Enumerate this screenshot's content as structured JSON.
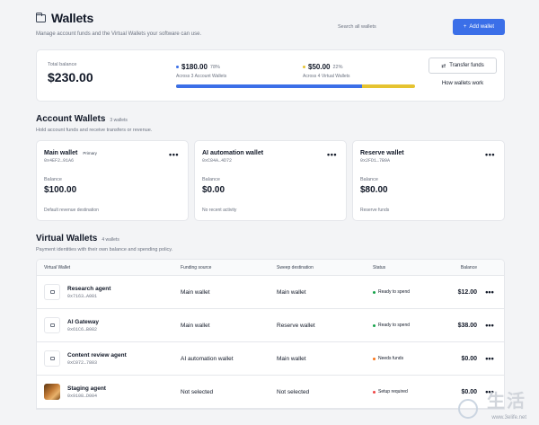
{
  "header": {
    "title": "Wallets",
    "subtitle": "Manage account funds and the Virtual Wallets your software can use.",
    "search_placeholder": "Search all wallets",
    "add_label": "Add wallet",
    "add_glyph": "+"
  },
  "summary": {
    "total_label": "Total balance",
    "total_value": "$230.00",
    "accounts_amount": "$180.00",
    "accounts_pct": "78%",
    "accounts_sub": "Across 3 Account Wallets",
    "virtual_amount": "$50.00",
    "virtual_pct": "22%",
    "virtual_sub": "Across 4 Virtual Wallets",
    "accounts_fraction": 0.78,
    "transfer_label": "Transfer funds",
    "transfer_glyph": "⇄",
    "how_label": "How wallets work",
    "colors": {
      "accounts": "#3b6fe8",
      "virtual": "#e5c331"
    }
  },
  "accounts": {
    "title": "Account Wallets",
    "count": "3 wallets",
    "subtitle": "Hold account funds and receive transfers or revenue.",
    "balance_label": "Balance",
    "more_glyph": "•••",
    "items": [
      {
        "name": "Main wallet",
        "badge": "Primary",
        "addr": "0x4EF2…91A6",
        "value": "$100.00",
        "foot": "Default revenue destination"
      },
      {
        "name": "AI automation wallet",
        "badge": "",
        "addr": "0xC84A…4D72",
        "value": "$0.00",
        "foot": "No recent activity"
      },
      {
        "name": "Reserve wallet",
        "badge": "",
        "addr": "0x2FD1…7B9A",
        "value": "$80.00",
        "foot": "Reserve funds"
      }
    ]
  },
  "virtual": {
    "title": "Virtual Wallets",
    "count": "4 wallets",
    "subtitle": "Payment identities with their own balance and spending policy.",
    "columns": [
      "Virtual Wallet",
      "Funding source",
      "Sweep destination",
      "Status",
      "Balance"
    ],
    "more_glyph": "•••",
    "rows": [
      {
        "name": "Research agent",
        "addr": "0x7163…A081",
        "funding": "Main wallet",
        "sweep": "Main wallet",
        "status": "Ready to spend",
        "balance": "$12.00"
      },
      {
        "name": "AI Gateway",
        "addr": "0x61C6…B082",
        "funding": "Main wallet",
        "sweep": "Reserve wallet",
        "status": "Ready to spend",
        "balance": "$38.00"
      },
      {
        "name": "Content review agent",
        "addr": "0xC072…7803",
        "funding": "AI automation wallet",
        "sweep": "Main wallet",
        "status": "Needs funds",
        "balance": "$0.00"
      },
      {
        "name": "Staging agent",
        "addr": "0x9108…D004",
        "funding": "Not selected",
        "sweep": "Not selected",
        "status": "Setup required",
        "balance": "$0.00"
      }
    ]
  },
  "watermark": {
    "text": "生活",
    "url": "www.3elife.net"
  }
}
